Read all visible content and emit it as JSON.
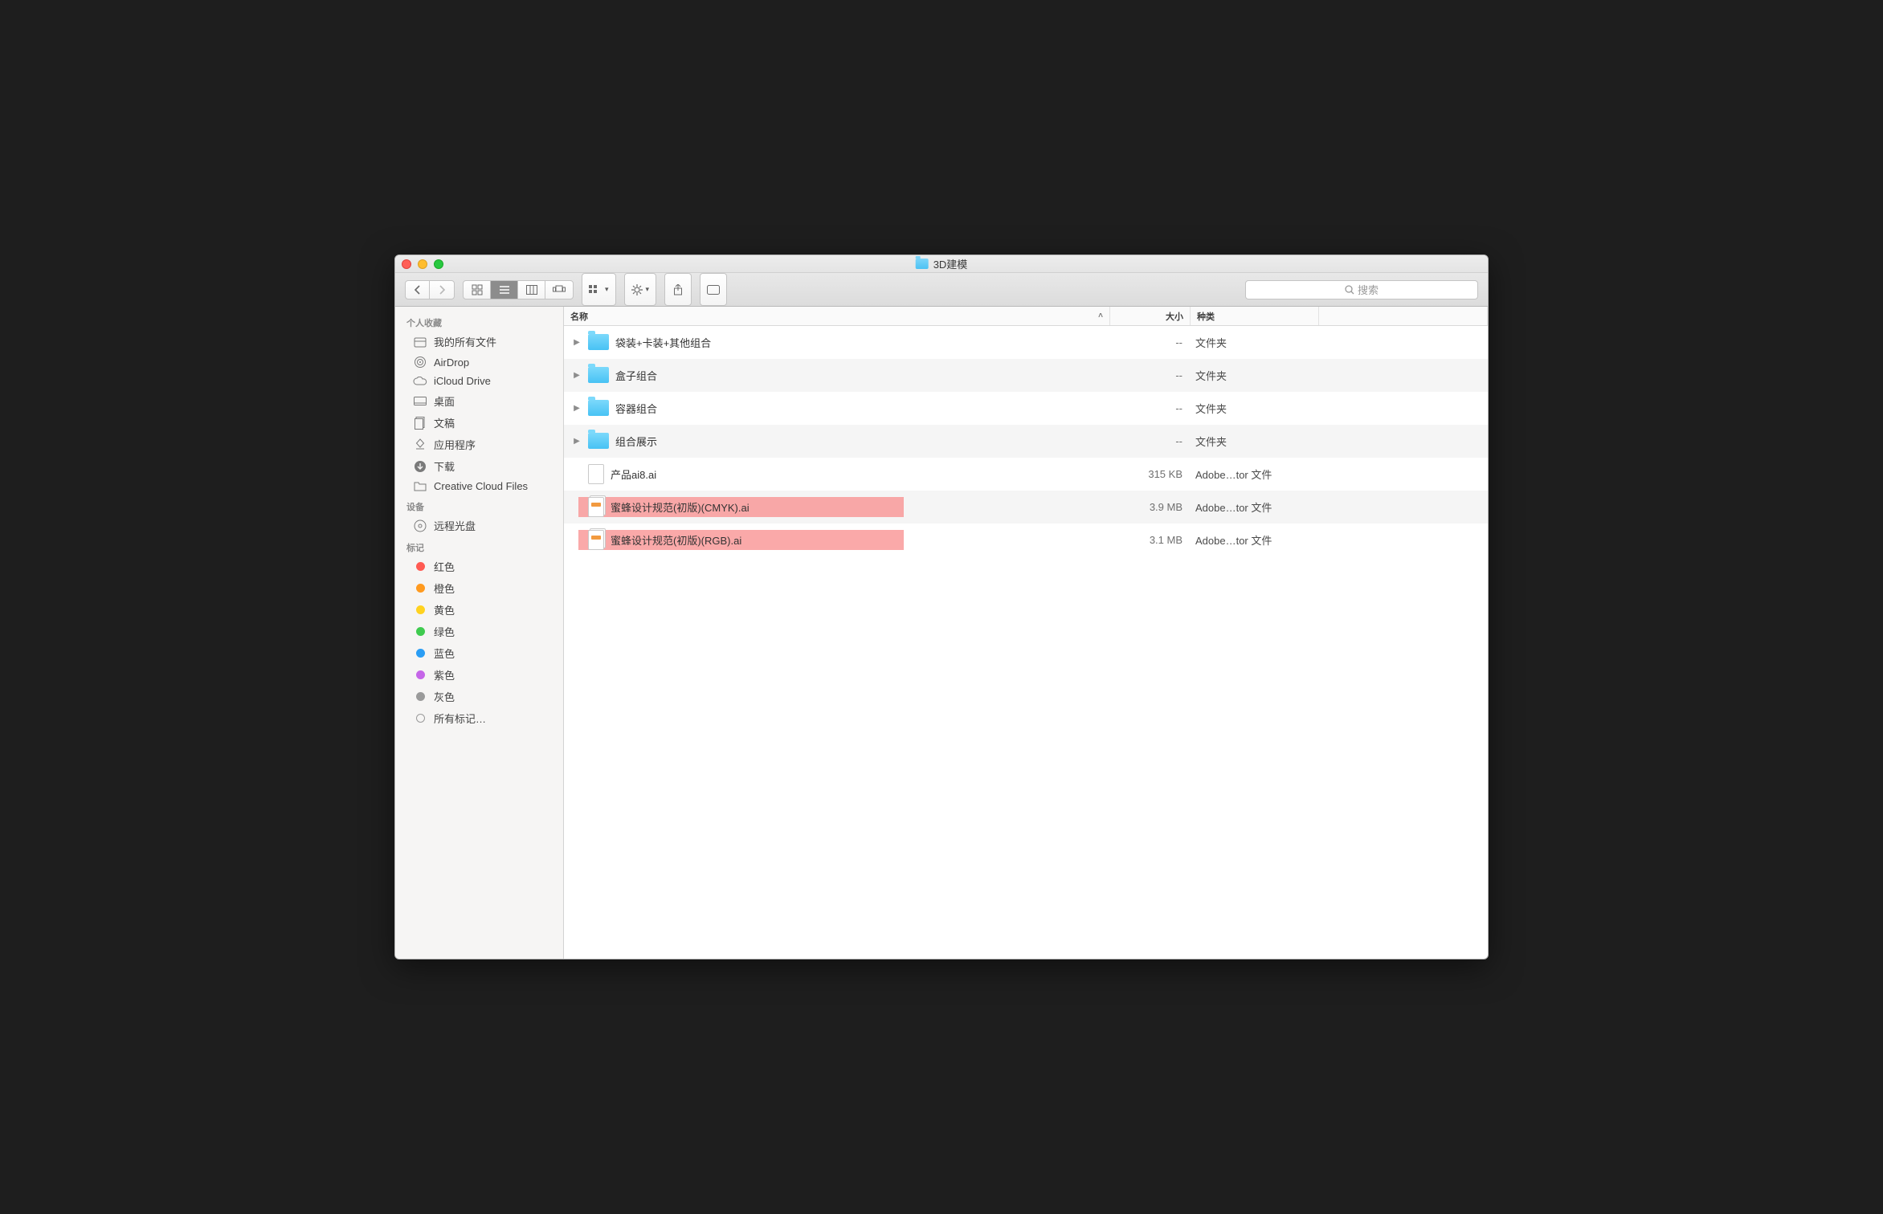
{
  "window": {
    "title": "3D建模"
  },
  "toolbar": {
    "search_placeholder": "搜索"
  },
  "sidebar": {
    "sections": [
      {
        "header": "个人收藏",
        "items": [
          {
            "icon": "all-files",
            "label": "我的所有文件"
          },
          {
            "icon": "airdrop",
            "label": "AirDrop"
          },
          {
            "icon": "icloud",
            "label": "iCloud Drive"
          },
          {
            "icon": "desktop",
            "label": "桌面"
          },
          {
            "icon": "documents",
            "label": "文稿"
          },
          {
            "icon": "apps",
            "label": "应用程序"
          },
          {
            "icon": "downloads",
            "label": "下载"
          },
          {
            "icon": "folder",
            "label": "Creative Cloud Files"
          }
        ]
      },
      {
        "header": "设备",
        "items": [
          {
            "icon": "disc",
            "label": "远程光盘"
          }
        ]
      },
      {
        "header": "标记",
        "items": [
          {
            "icon": "tag",
            "color": "#ff5a52",
            "label": "红色"
          },
          {
            "icon": "tag",
            "color": "#ff9a1f",
            "label": "橙色"
          },
          {
            "icon": "tag",
            "color": "#ffd21f",
            "label": "黄色"
          },
          {
            "icon": "tag",
            "color": "#3fcb4f",
            "label": "绿色"
          },
          {
            "icon": "tag",
            "color": "#2a9df4",
            "label": "蓝色"
          },
          {
            "icon": "tag",
            "color": "#c566e8",
            "label": "紫色"
          },
          {
            "icon": "tag",
            "color": "#9a9a9a",
            "label": "灰色"
          },
          {
            "icon": "tag-all",
            "label": "所有标记…"
          }
        ]
      }
    ]
  },
  "columns": {
    "name": "名称",
    "size": "大小",
    "kind": "种类"
  },
  "files": [
    {
      "type": "folder",
      "name": "袋装+卡装+其他组合",
      "size": "--",
      "kind": "文件夹",
      "disclosure": true
    },
    {
      "type": "folder",
      "name": "盒子组合",
      "size": "--",
      "kind": "文件夹",
      "disclosure": true
    },
    {
      "type": "folder",
      "name": "容器组合",
      "size": "--",
      "kind": "文件夹",
      "disclosure": true
    },
    {
      "type": "folder",
      "name": "组合展示",
      "size": "--",
      "kind": "文件夹",
      "disclosure": true
    },
    {
      "type": "file",
      "name": "产品ai8.ai",
      "size": "315 KB",
      "kind": "Adobe…tor 文件",
      "icon": "plain"
    },
    {
      "type": "file",
      "name": "蜜蜂设计规范(初版)(CMYK).ai",
      "size": "3.9 MB",
      "kind": "Adobe…tor 文件",
      "icon": "orange",
      "highlight": true
    },
    {
      "type": "file",
      "name": "蜜蜂设计规范(初版)(RGB).ai",
      "size": "3.1 MB",
      "kind": "Adobe…tor 文件",
      "icon": "orange",
      "highlight": true
    }
  ]
}
